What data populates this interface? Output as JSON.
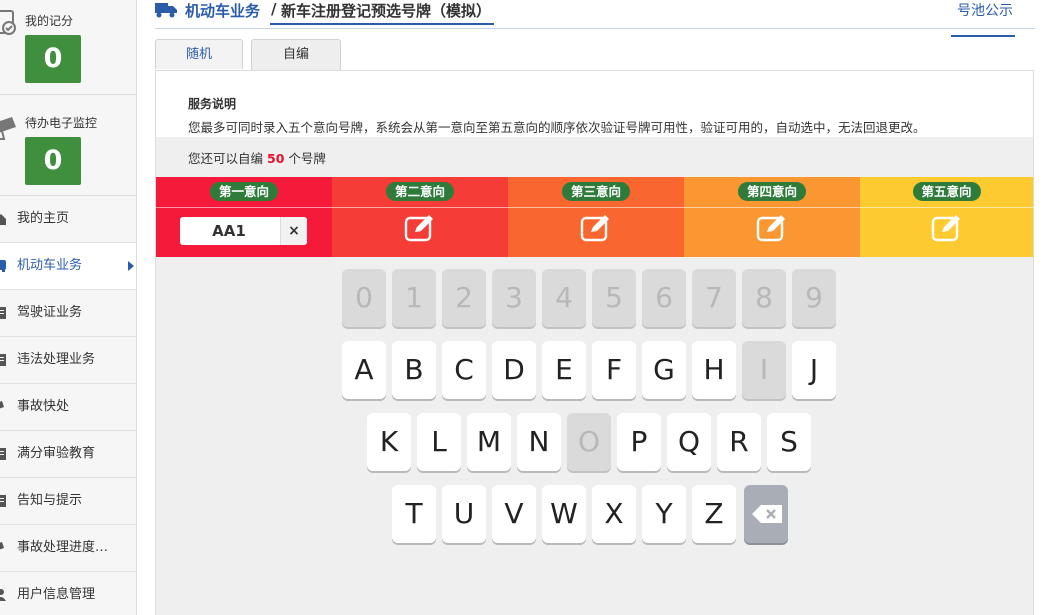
{
  "sidebar": {
    "score": {
      "label": "我的记分",
      "value": "0"
    },
    "monitor": {
      "label": "待办电子监控",
      "value": "0"
    },
    "items": [
      {
        "label": "我的主页",
        "icon": "home-icon"
      },
      {
        "label": "机动车业务",
        "icon": "car-icon",
        "active": true
      },
      {
        "label": "驾驶证业务",
        "icon": "document-icon"
      },
      {
        "label": "违法处理业务",
        "icon": "document-icon"
      },
      {
        "label": "事故快处",
        "icon": "car-crash-icon"
      },
      {
        "label": "满分审验教育",
        "icon": "document-icon"
      },
      {
        "label": "告知与提示",
        "icon": "document-icon"
      },
      {
        "label": "事故处理进度…",
        "icon": "car-crash-icon"
      },
      {
        "label": "用户信息管理",
        "icon": "user-icon"
      }
    ]
  },
  "header": {
    "section": "机动车业务",
    "separator": "/",
    "page": "新车注册登记预选号牌（模拟）",
    "pool_link": "号池公示"
  },
  "tabs": [
    {
      "label": "随机"
    },
    {
      "label": "自编",
      "active": true
    }
  ],
  "service": {
    "title": "服务说明",
    "text": "您最多可同时录入五个意向号牌，系统会从第一意向至第五意向的顺序依次验证号牌可用性，验证可用的，自动选中，无法回退更改。"
  },
  "remain": {
    "prefix": "您还可以自编",
    "count": "50",
    "suffix": "个号牌"
  },
  "choices": [
    {
      "label": "第一意向",
      "plate": "AA1",
      "color": "#f5193a"
    },
    {
      "label": "第二意向",
      "color": "#f63c36"
    },
    {
      "label": "第三意向",
      "color": "#f9662f"
    },
    {
      "label": "第四意向",
      "color": "#fa9730"
    },
    {
      "label": "第五意向",
      "color": "#fdcb2f"
    }
  ],
  "keyboard": {
    "digits": [
      "0",
      "1",
      "2",
      "3",
      "4",
      "5",
      "6",
      "7",
      "8",
      "9"
    ],
    "row1": [
      "A",
      "B",
      "C",
      "D",
      "E",
      "F",
      "G",
      "H",
      "I",
      "J"
    ],
    "row2": [
      "K",
      "L",
      "M",
      "N",
      "O",
      "P",
      "Q",
      "R",
      "S"
    ],
    "row3": [
      "T",
      "U",
      "V",
      "W",
      "X",
      "Y",
      "Z"
    ],
    "disabled": [
      "0",
      "1",
      "2",
      "3",
      "4",
      "5",
      "6",
      "7",
      "8",
      "9",
      "I",
      "O"
    ],
    "backspace_icon": "backspace-icon"
  }
}
